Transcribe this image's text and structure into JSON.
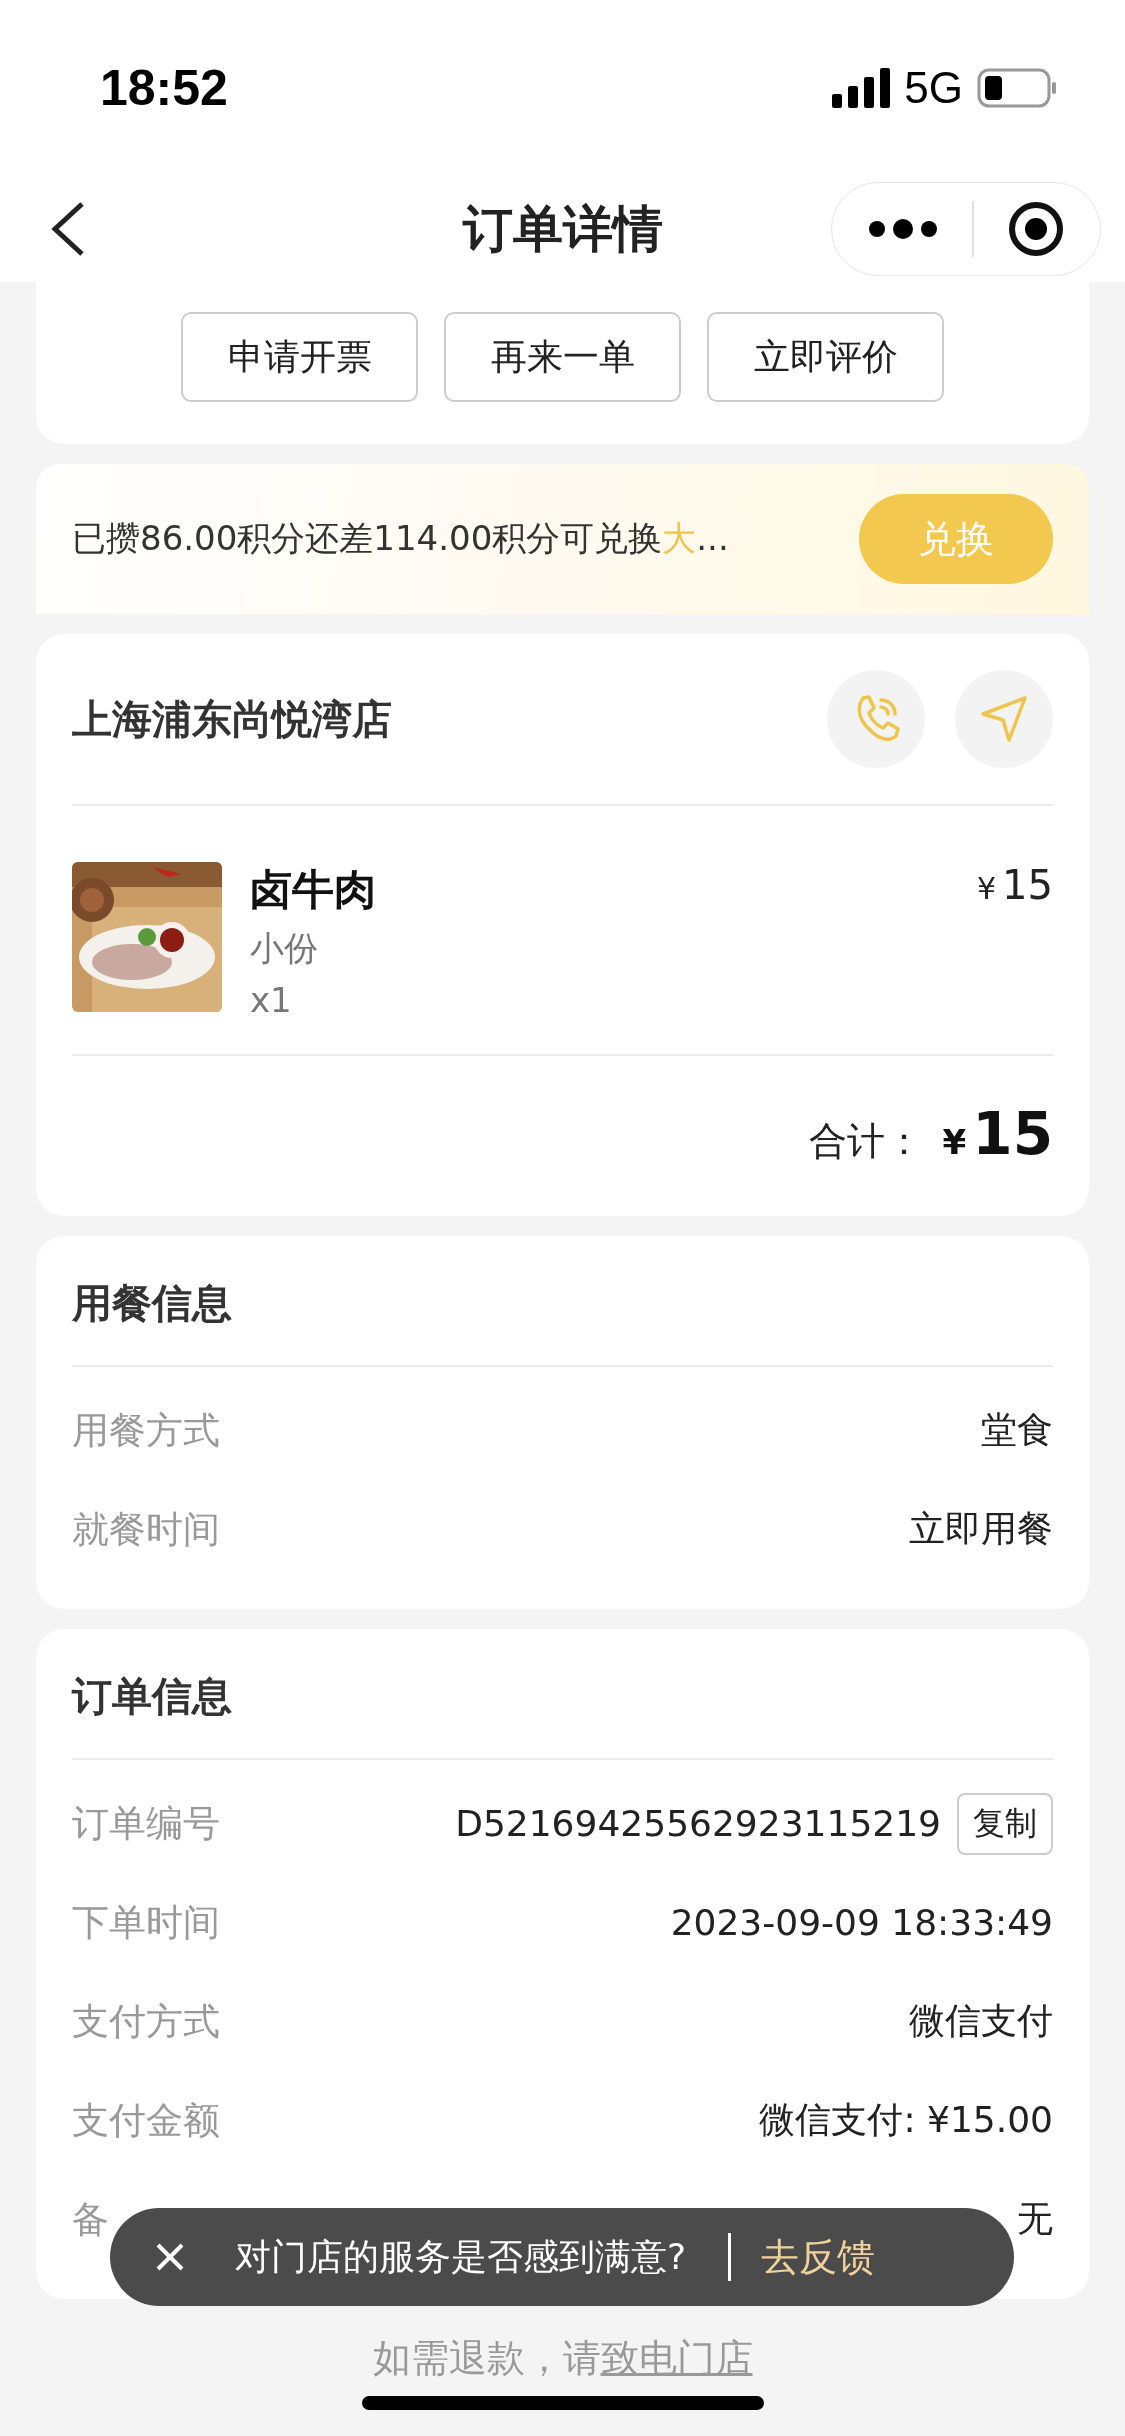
{
  "status_bar": {
    "time": "18:52",
    "network": "5G"
  },
  "nav": {
    "title": "订单详情"
  },
  "actions": [
    "申请开票",
    "再来一单",
    "立即评价"
  ],
  "points_banner": {
    "text": "已攒86.00积分还差114.00积分可兑换",
    "highlight": "大",
    "ellipsis": "...",
    "button": "兑换"
  },
  "store": {
    "name": "上海浦东尚悦湾店",
    "items": [
      {
        "kind": "picture",
        "name": "卤牛肉",
        "spec": "小份",
        "qty": "x1",
        "currency": "¥",
        "price": "15"
      }
    ],
    "total": {
      "label": "合计：",
      "currency": "¥",
      "amount": "15"
    }
  },
  "dining_info": {
    "title": "用餐信息",
    "rows": [
      {
        "label": "用餐方式",
        "value": "堂食"
      },
      {
        "label": "就餐时间",
        "value": "立即用餐"
      }
    ]
  },
  "order_info": {
    "title": "订单信息",
    "rows": [
      {
        "label": "订单编号",
        "value": "D52169425562923115219",
        "action": "复制"
      },
      {
        "label": "下单时间",
        "value": "2023-09-09 18:33:49"
      },
      {
        "label": "支付方式",
        "value": "微信支付"
      },
      {
        "label": "支付金额",
        "value": "微信支付: ¥15.00"
      },
      {
        "label": "备",
        "value": "无"
      }
    ]
  },
  "feedback_toast": {
    "text": "对门店的服务是否感到满意?",
    "link": "去反馈"
  },
  "footer": {
    "text": "如需退款，请",
    "link": "致电门店"
  }
}
